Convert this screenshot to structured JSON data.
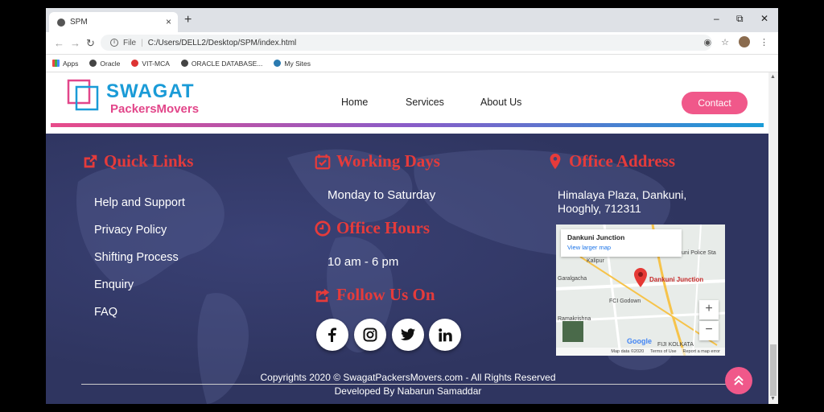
{
  "browser": {
    "tab_title": "SPM",
    "tab_close": "×",
    "new_tab": "+",
    "url_scheme": "File",
    "url": "C:/Users/DELL2/Desktop/SPM/index.html",
    "bookmarks": [
      "Apps",
      "Oracle",
      "VIT-MCA",
      "ORACLE DATABASE...",
      "My Sites"
    ]
  },
  "header": {
    "logo_title": "SWAGAT",
    "logo_subtitle": "PackersMovers",
    "nav": [
      "Home",
      "Services",
      "About Us"
    ],
    "contact_label": "Contact"
  },
  "footer": {
    "quick_links": {
      "title": "Quick Links",
      "items": [
        "Help and Support",
        "Privacy Policy",
        "Shifting Process",
        "Enquiry",
        "FAQ"
      ]
    },
    "working_days": {
      "title": "Working Days",
      "value": "Monday to Saturday"
    },
    "office_hours": {
      "title": "Office Hours",
      "value": "10 am - 6 pm"
    },
    "follow_us": {
      "title": "Follow Us On",
      "networks": [
        "facebook",
        "instagram",
        "twitter",
        "linkedin"
      ]
    },
    "office_address": {
      "title": "Office Address",
      "line1": "Himalaya Plaza, Dankuni,",
      "line2": "Hooghly, 712311"
    },
    "map": {
      "card_title": "Dankuni Junction",
      "card_link": "View larger map",
      "pin_label": "Dankuni Junction",
      "labels": [
        "Garalgacha",
        "FCI Godown",
        "Ramakrishna",
        "Kalipur",
        "uni Police Sta",
        "Google",
        "FIJI KOLKATA"
      ],
      "footer": [
        "Map data ©2020",
        "Terms of Use",
        "Report a map error"
      ]
    },
    "copyright": "Copyrights 2020 © SwagatPackersMovers.com - All Rights Reserved",
    "developed_by": "Developed By Nabarun Samaddar"
  },
  "colors": {
    "accent_pink": "#f0588a",
    "brand_blue": "#1a9bd7",
    "title_red": "#e53b3b",
    "footer_bg": "#2f3560"
  }
}
